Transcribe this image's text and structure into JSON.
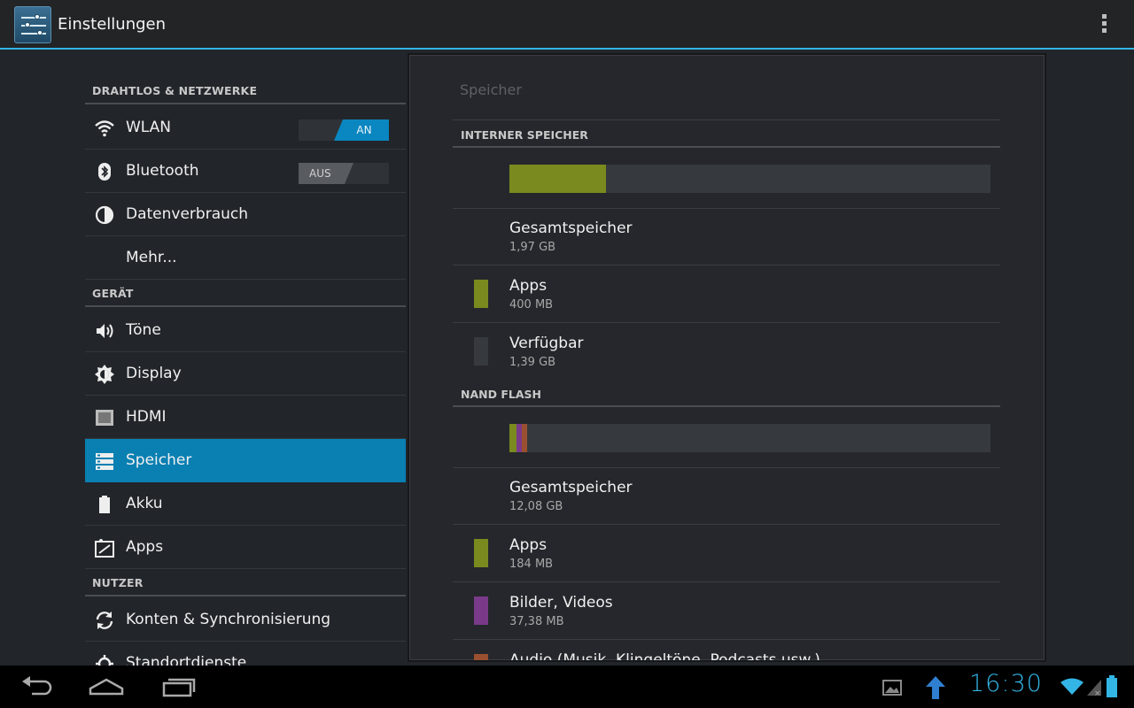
{
  "actionbar": {
    "title": "Einstellungen",
    "app_icon": "settings-sliders-icon",
    "overflow_icon": "overflow-menu-icon"
  },
  "left": {
    "sections": [
      {
        "title": "DRAHTLOS & NETZWERKE"
      },
      {
        "title": "GERÄT"
      },
      {
        "title": "NUTZER"
      }
    ],
    "items": [
      {
        "label": "WLAN",
        "icon": "wifi-icon",
        "toggle": "AN"
      },
      {
        "label": "Bluetooth",
        "icon": "bluetooth-icon",
        "toggle": "AUS"
      },
      {
        "label": "Datenverbrauch",
        "icon": "data-usage-icon"
      },
      {
        "label": "Mehr...",
        "icon": ""
      },
      {
        "label": "Töne",
        "icon": "speaker-icon"
      },
      {
        "label": "Display",
        "icon": "brightness-icon"
      },
      {
        "label": "HDMI",
        "icon": "hdmi-icon"
      },
      {
        "label": "Speicher",
        "icon": "storage-icon",
        "selected": true
      },
      {
        "label": "Akku",
        "icon": "battery-icon"
      },
      {
        "label": "Apps",
        "icon": "apps-icon"
      },
      {
        "label": "Konten & Synchronisierung",
        "icon": "sync-icon"
      },
      {
        "label": "Standortdienste",
        "icon": "location-icon"
      }
    ]
  },
  "panel": {
    "title": "Speicher",
    "internal": {
      "title": "INTERNER SPEICHER",
      "usage_fractions": [
        {
          "color": "#7a8a1e",
          "fraction": 0.2
        }
      ],
      "rows": [
        {
          "name": "Gesamtspeicher",
          "size": "1,97 GB"
        },
        {
          "name": "Apps",
          "size": "400 MB",
          "color": "#7a8a1e"
        },
        {
          "name": "Verfügbar",
          "size": "1,39 GB",
          "color": "#36393d"
        }
      ]
    },
    "nand": {
      "title": "NAND FLASH",
      "usage_fractions": [
        {
          "color": "#7a8a1e",
          "fraction": 0.015
        },
        {
          "color": "#7a3a8a",
          "fraction": 0.011
        },
        {
          "color": "#9a5030",
          "fraction": 0.011
        }
      ],
      "rows": [
        {
          "name": "Gesamtspeicher",
          "size": "12,08 GB"
        },
        {
          "name": "Apps",
          "size": "184 MB",
          "color": "#7a8a1e"
        },
        {
          "name": "Bilder, Videos",
          "size": "37,38 MB",
          "color": "#7a3a8a"
        },
        {
          "name": "Audio (Musik, Klingeltöne, Podcasts usw.)",
          "size": "",
          "color": "#9a5030"
        }
      ]
    }
  },
  "statusbar": {
    "time": "16:30",
    "icons": [
      "gallery-notification-icon",
      "upload-notification-icon",
      "wifi-status-icon",
      "signal-icon",
      "battery-status-icon"
    ]
  },
  "navbar": {
    "buttons": [
      "back-icon",
      "home-icon",
      "recent-apps-icon"
    ]
  }
}
